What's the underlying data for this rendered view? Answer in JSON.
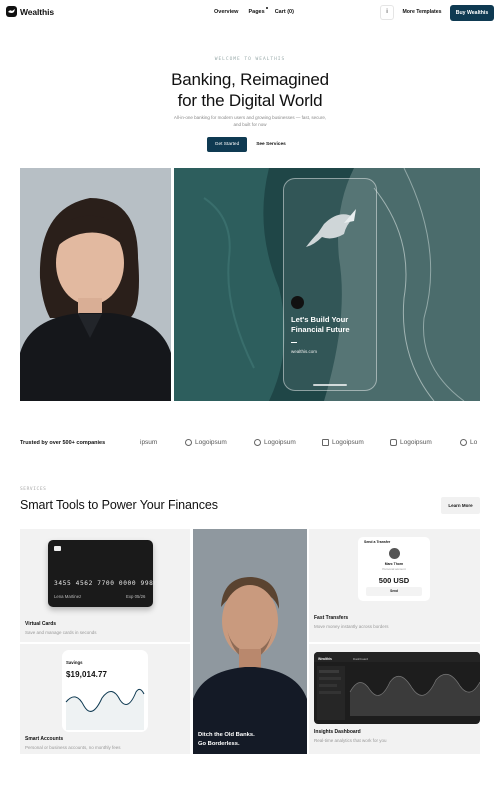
{
  "nav": {
    "brand": "Wealthis",
    "links": [
      "Overview",
      "Pages",
      "Cart (0)"
    ],
    "icon_button": "i",
    "more_templates": "More Templates",
    "buy": "Buy Wealthis"
  },
  "hero": {
    "eyebrow": "WELCOME TO WEALTHIS",
    "title_line1": "Banking, Reimagined",
    "title_line2": "for the Digital World",
    "subtitle": "All-in-one banking for modern users and growing businesses — fast, secure, and built for now",
    "cta_primary": "Get Started",
    "cta_secondary": "See Services",
    "phone_title": "Let's Build Your Financial Future",
    "phone_dash": "–",
    "phone_url": "wealthis.com"
  },
  "trusted": {
    "label": "Trusted by over 500+ companies",
    "logos": [
      "ipsum",
      "Logoipsum",
      "Logoipsum",
      "Logoipsum",
      "Logoipsum",
      "Lo"
    ]
  },
  "services": {
    "eyebrow": "SERVICES",
    "title": "Smart Tools to Power Your Finances",
    "learn_more": "Learn More",
    "cards": [
      {
        "title": "Virtual Cards",
        "desc": "Save and manage cards in seconds"
      },
      {
        "title": "Smart Accounts",
        "desc": "Personal or business accounts, no monthly fees"
      },
      {
        "title": "Fast Transfers",
        "desc": "Move money instantly across borders"
      },
      {
        "title": "Insights Dashboard",
        "desc": "Real-time analytics that work for you"
      }
    ],
    "portrait_caption_line1": "Ditch the Old Banks.",
    "portrait_caption_line2": "Go Borderless."
  },
  "virtual_card": {
    "number": "3455 4562 7700 0000 9986",
    "name": "Lena Martinez",
    "expiry": "Exp 05/26"
  },
  "savings": {
    "label": "Savings",
    "value": "$19,014.77"
  },
  "transfer": {
    "header": "Send a Transfer",
    "name": "Marc Thorn",
    "sub": "Personal account",
    "amount": "500 USD",
    "send": "Send"
  },
  "dashboard": {
    "brand": "Wealthis",
    "title": "Dashboard"
  },
  "colors": {
    "brand_dark": "#0f3a52",
    "card_bg": "#f2f2f2"
  }
}
